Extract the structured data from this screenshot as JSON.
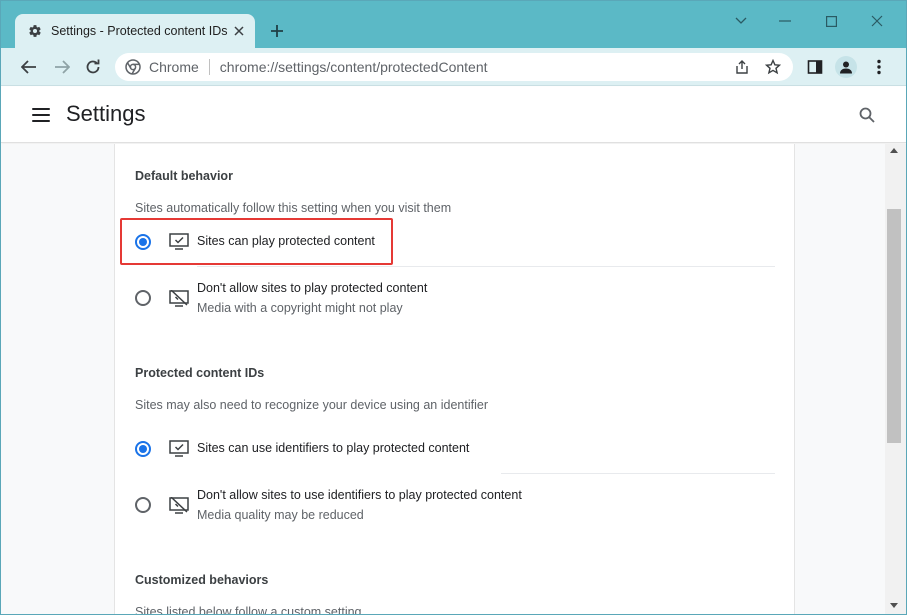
{
  "browser": {
    "tab_title": "Settings - Protected content IDs",
    "omnibox_label": "Chrome",
    "url": "chrome://settings/content/protectedContent"
  },
  "settings": {
    "title": "Settings"
  },
  "default_behavior": {
    "title": "Default behavior",
    "subtitle": "Sites automatically follow this setting when you visit them",
    "options": [
      {
        "label": "Sites can play protected content",
        "sublabel": "",
        "selected": true
      },
      {
        "label": "Don't allow sites to play protected content",
        "sublabel": "Media with a copyright might not play",
        "selected": false
      }
    ]
  },
  "protected_ids": {
    "title": "Protected content IDs",
    "subtitle": "Sites may also need to recognize your device using an identifier",
    "options": [
      {
        "label": "Sites can use identifiers to play protected content",
        "sublabel": "",
        "selected": true
      },
      {
        "label": "Don't allow sites to use identifiers to play protected content",
        "sublabel": "Media quality may be reduced",
        "selected": false
      }
    ]
  },
  "customized": {
    "title": "Customized behaviors",
    "subtitle": "Sites listed below follow a custom setting"
  },
  "colors": {
    "accent": "#1a73e8",
    "highlight": "#e53935",
    "frame": "#5bb9c6"
  }
}
